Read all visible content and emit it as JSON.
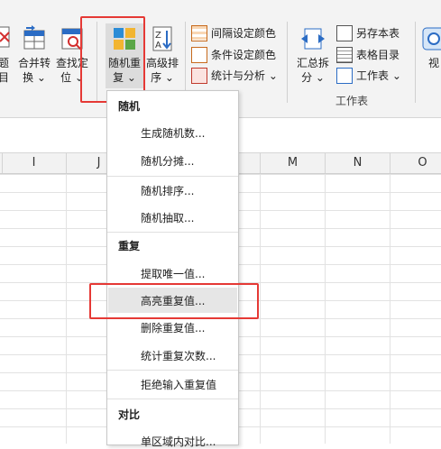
{
  "ribbon": {
    "buttons": [
      {
        "id": "left_partial",
        "line1": "题",
        "line2": "目"
      },
      {
        "id": "merge",
        "line1": "合并转",
        "line2": "换 ⌄"
      },
      {
        "id": "find",
        "line1": "查找定",
        "line2": "位 ⌄"
      },
      {
        "id": "random",
        "line1": "随机重",
        "line2": "复 ⌄"
      },
      {
        "id": "sort",
        "line1": "高级排",
        "line2": "序 ⌄"
      },
      {
        "id": "summary",
        "line1": "汇总拆",
        "line2": "分 ⌄"
      },
      {
        "id": "view",
        "line1": "视"
      }
    ],
    "small_items": {
      "interval_color": "间隔设定颜色",
      "cond_color": "条件设定颜色",
      "stats": "统计与分析 ⌄",
      "save_sheet": "另存本表",
      "toc": "表格目录",
      "worksheet": "工作表 ⌄"
    },
    "group_labels": {
      "worksheet_group": "工作表"
    }
  },
  "columns": [
    "I",
    "J",
    "M",
    "N",
    "O"
  ],
  "menu": {
    "sections": [
      {
        "title": "随机",
        "items": [
          "生成随机数...",
          "随机分摊...",
          "随机排序...",
          "随机抽取..."
        ]
      },
      {
        "title": "重复",
        "items": [
          "提取唯一值...",
          "高亮重复值...",
          "删除重复值...",
          "统计重复次数...",
          "拒绝输入重复值"
        ]
      },
      {
        "title": "对比",
        "items": [
          "单区域内对比..."
        ]
      }
    ],
    "highlighted": "高亮重复值..."
  },
  "colors": {
    "highlight_box": "#e53935",
    "accent_blue": "#2b6cc4"
  }
}
